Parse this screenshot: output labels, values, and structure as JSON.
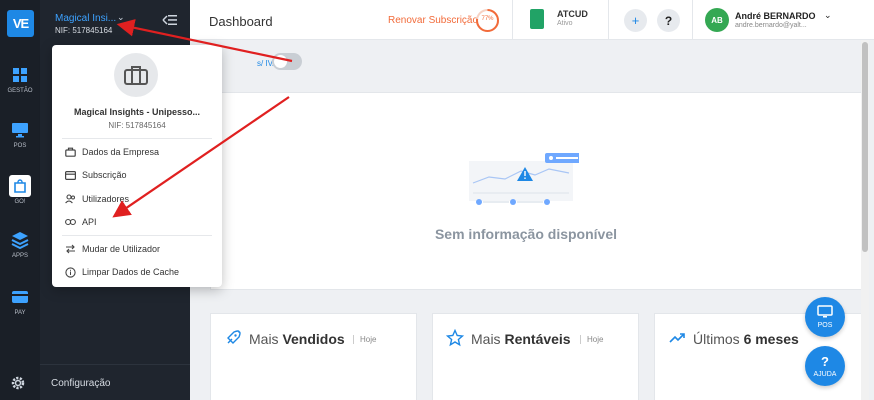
{
  "brand": {
    "logo_text": "VE"
  },
  "rail": [
    {
      "label": "GESTÃO",
      "icon": "grid-icon"
    },
    {
      "label": "POS",
      "icon": "monitor-icon"
    },
    {
      "label": "GO!",
      "icon": "shopping-bag-icon"
    },
    {
      "label": "APPS",
      "icon": "layers-icon"
    },
    {
      "label": "PAY",
      "icon": "card-icon"
    }
  ],
  "sidebar": {
    "company_name": "Magical Insi...",
    "nif": "NIF: 517845164",
    "config_label": "Configuração"
  },
  "topbar": {
    "title": "Dashboard",
    "renew_label": "Renovar Subscrição",
    "progress_text": "77%",
    "progress_value": 0.77,
    "atcud_title": "ATCUD",
    "atcud_status": "Ativo",
    "user_initials": "AB",
    "user_name": "André BERNARDO",
    "user_email": "andre.bernardo@yalt..."
  },
  "main": {
    "iva_label": "s/ IVA",
    "empty_text": "Sem informação disponível",
    "cards": [
      {
        "title_prefix": "Mais ",
        "title_bold": "Vendidos",
        "period": "Hoje"
      },
      {
        "title_prefix": "Mais ",
        "title_bold": "Rentáveis",
        "period": "Hoje"
      },
      {
        "title_prefix": "Últimos ",
        "title_bold": "6 meses",
        "period": ""
      }
    ]
  },
  "fabs": {
    "pos_label": "POS",
    "help_label": "AJUDA"
  },
  "dropdown": {
    "company_full": "Magical Insights - Unipesso...",
    "nif": "NIF: 517845164",
    "items": [
      {
        "label": "Dados da Empresa",
        "icon": "briefcase-icon"
      },
      {
        "label": "Subscrição",
        "icon": "card-icon"
      },
      {
        "label": "Utilizadores",
        "icon": "users-icon"
      },
      {
        "label": "API",
        "icon": "link-icon"
      },
      {
        "label": "Mudar de Utilizador",
        "icon": "swap-icon"
      },
      {
        "label": "Limpar Dados de Cache",
        "icon": "info-icon"
      }
    ]
  },
  "colors": {
    "accent": "#1e88e5",
    "renew": "#f26b3a",
    "annotation": "#e02020"
  }
}
